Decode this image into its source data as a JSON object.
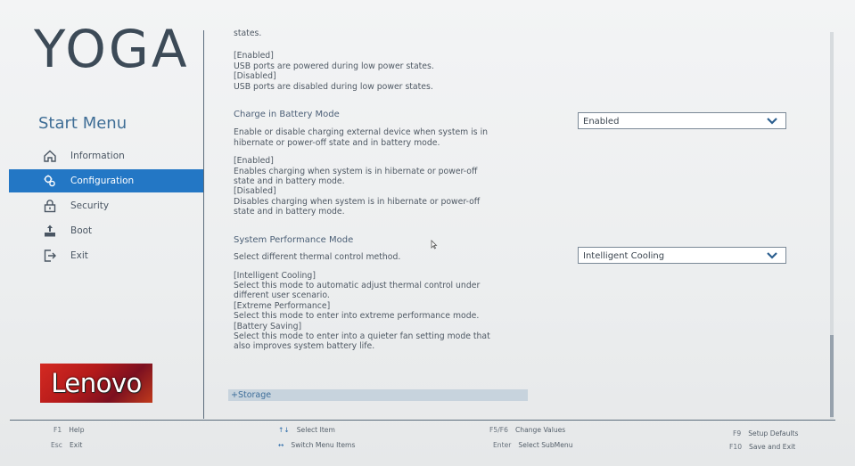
{
  "brand": {
    "product": "YOGA",
    "vendor": "Lenovo"
  },
  "sidebar": {
    "heading": "Start Menu",
    "items": [
      {
        "label": "Information",
        "icon": "home-icon",
        "active": false
      },
      {
        "label": "Configuration",
        "icon": "configuration-icon",
        "active": true
      },
      {
        "label": "Security",
        "icon": "lock-icon",
        "active": false
      },
      {
        "label": "Boot",
        "icon": "boot-icon",
        "active": false
      },
      {
        "label": "Exit",
        "icon": "exit-icon",
        "active": false
      }
    ]
  },
  "content": {
    "usb_cont": "states.",
    "usb_enabled_tag": "[Enabled]",
    "usb_enabled_desc": "USB ports are powered during low power states.",
    "usb_disabled_tag": "[Disabled]",
    "usb_disabled_desc": "USB ports are disabled during low power states.",
    "charge_title": "Charge in Battery Mode",
    "charge_desc_1": "Enable or disable charging external device when system is in",
    "charge_desc_2": "hibernate or power-off state and in battery mode.",
    "charge_enabled_tag": "[Enabled]",
    "charge_enabled_1": "Enables charging when system is in hibernate or power-off",
    "charge_enabled_2": "state and in battery mode.",
    "charge_disabled_tag": "[Disabled]",
    "charge_disabled_1": "Disables charging when system is in hibernate or power-off",
    "charge_disabled_2": "state and in battery mode.",
    "perf_title": "System Performance Mode",
    "perf_desc": "Select different thermal control method.",
    "ic_tag": "[Intelligent Cooling]",
    "ic_1": "Select this mode to automatic adjust thermal control under",
    "ic_2": "different user scenario.",
    "ep_tag": "[Extreme Performance]",
    "ep_1": "Select this mode to enter into extreme performance mode.",
    "bs_tag": "[Battery Saving]",
    "bs_1": "Select this mode to enter into a quieter fan setting mode that",
    "bs_2": "also improves system battery life.",
    "storage": "+Storage"
  },
  "settings": {
    "charge_value": "Enabled",
    "perf_value": "Intelligent Cooling"
  },
  "footer": {
    "f1_key": "F1",
    "f1_label": "Help",
    "esc_key": "Esc",
    "esc_label": "Exit",
    "select_item_key": "↑↓",
    "select_item_label": "Select Item",
    "switch_key": "↔",
    "switch_label": "Switch Menu Items",
    "f5f6_key": "F5/F6",
    "f5f6_label": "Change Values",
    "enter_key": "Enter",
    "enter_label": "Select SubMenu",
    "f9_key": "F9",
    "f9_label": "Setup Defaults",
    "f10_key": "F10",
    "f10_label": "Save and Exit"
  },
  "colors": {
    "accent": "#2377c5",
    "heading_blue": "#3f6e96",
    "storage_bg": "#c7d3dd"
  }
}
